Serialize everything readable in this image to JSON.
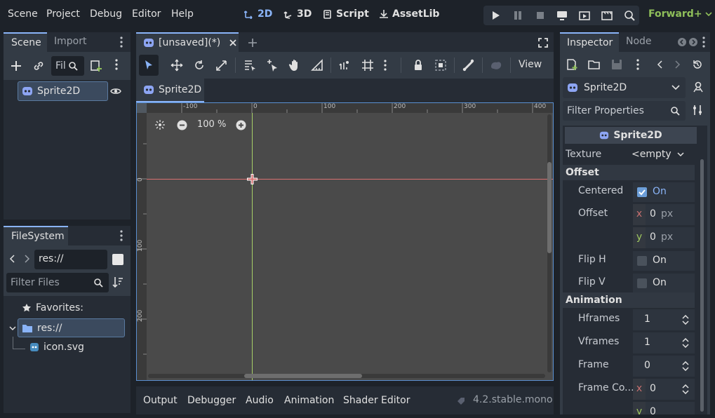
{
  "menu": [
    "Scene",
    "Project",
    "Debug",
    "Editor",
    "Help"
  ],
  "workspaces": [
    {
      "label": "2D",
      "icon": "2d-icon",
      "active": true
    },
    {
      "label": "3D",
      "icon": "3d-icon",
      "active": false
    },
    {
      "label": "Script",
      "icon": "script-icon",
      "active": false
    },
    {
      "label": "AssetLib",
      "icon": "assetlib-icon",
      "active": false
    }
  ],
  "renderer": "Forward+",
  "scene_dock": {
    "tabs": [
      "Scene",
      "Import"
    ],
    "filter_placeholder": "Fil",
    "node": "Sprite2D"
  },
  "filesystem": {
    "title": "FileSystem",
    "path": "res://",
    "filter_placeholder": "Filter Files",
    "favorites": "Favorites:",
    "root": "res://",
    "files": [
      "icon.svg"
    ]
  },
  "editor": {
    "scene_tab": "[unsaved](*)",
    "breadcrumb": "Sprite2D",
    "view_menu": "View",
    "zoom": "100 %",
    "ruler_top": [
      "-100",
      "0",
      "100",
      "200",
      "300",
      "400"
    ],
    "ruler_left": [
      "0",
      "100",
      "200"
    ]
  },
  "bottom": {
    "tabs": [
      "Output",
      "Debugger",
      "Audio",
      "Animation",
      "Shader Editor"
    ],
    "version": "4.2.stable.mono"
  },
  "inspector": {
    "tabs": [
      "Inspector",
      "Node"
    ],
    "node_type": "Sprite2D",
    "filter_placeholder": "Filter Properties",
    "header": "Sprite2D",
    "texture_label": "Texture",
    "texture_value": "<empty",
    "offset_section": "Offset",
    "centered_label": "Centered",
    "centered_value": "On",
    "offset_label": "Offset",
    "offset_x": "0",
    "offset_y": "0",
    "px": "px",
    "x": "x",
    "y": "y",
    "fliph_label": "Flip H",
    "fliph_value": "On",
    "flipv_label": "Flip V",
    "flipv_value": "On",
    "animation_section": "Animation",
    "hframes_label": "Hframes",
    "hframes_value": "1",
    "vframes_label": "Vframes",
    "vframes_value": "1",
    "frame_label": "Frame",
    "frame_value": "0",
    "framecoords_label": "Frame Co...",
    "framecoords_x": "0",
    "framecoords_y": "0"
  },
  "colors": {
    "accent": "#8ab4f8",
    "bg": "#1d2229",
    "panel": "#262c35",
    "canvas": "#4a4a4a",
    "renderer": "#8fbf5a"
  }
}
